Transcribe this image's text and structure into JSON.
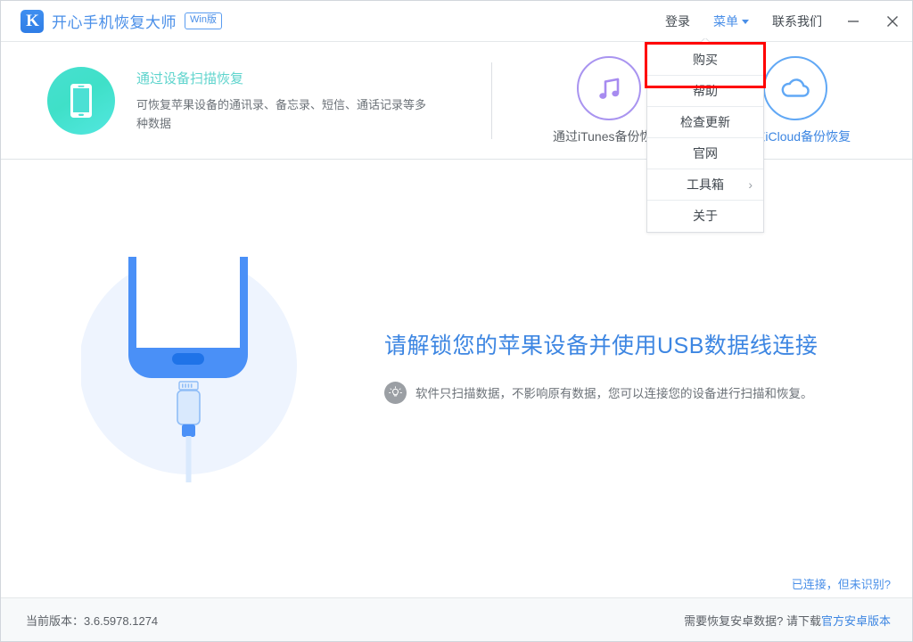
{
  "titlebar": {
    "logo_letter": "K",
    "app_name": "开心手机恢复大师",
    "platform_badge": "Win版",
    "login_label": "登录",
    "menu_label": "菜单",
    "contact_label": "联系我们",
    "minimize_icon": "minimize-icon",
    "close_icon": "close-icon",
    "accent_color": "#4a8fe8"
  },
  "menu_dropdown": {
    "highlighted_index": 0,
    "highlight_color": "#ff0000",
    "items": [
      {
        "label": "购买",
        "submenu": false
      },
      {
        "label": "帮助",
        "submenu": false
      },
      {
        "label": "检查更新",
        "submenu": false
      },
      {
        "label": "官网",
        "submenu": false
      },
      {
        "label": "工具箱",
        "submenu": true,
        "submenu_glyph": "›"
      },
      {
        "label": "关于",
        "submenu": false
      }
    ]
  },
  "features": {
    "primary": {
      "icon": "phone-icon",
      "icon_color": "#47e0d0",
      "title": "通过设备扫描恢复",
      "title_color": "#5fd4cd",
      "description": "可恢复苹果设备的通讯录、备忘录、短信、通话记录等多种数据"
    },
    "alternates": [
      {
        "icon": "music-note-icon",
        "icon_color": "#a994f0",
        "label": "通过iTunes备份恢复"
      },
      {
        "icon": "cloud-icon",
        "icon_color": "#61a8f5",
        "label": "通过iCloud备份恢复"
      }
    ]
  },
  "main": {
    "illustration": "phone-with-lightning-cable-illustration",
    "headline": "请解锁您的苹果设备并使用USB数据线连接",
    "headline_color": "#3d86e2",
    "tip_icon": "lightbulb-icon",
    "tip_text": "软件只扫描数据，不影响原有数据，您可以连接您的设备进行扫描和恢复。"
  },
  "status": {
    "connection_link": "已连接，但未识别?"
  },
  "footer": {
    "version_label": "当前版本：",
    "version_value": "3.6.5978.1274",
    "android_prompt": "需要恢复安卓数据? 请下载",
    "android_link": "官方安卓版本"
  }
}
